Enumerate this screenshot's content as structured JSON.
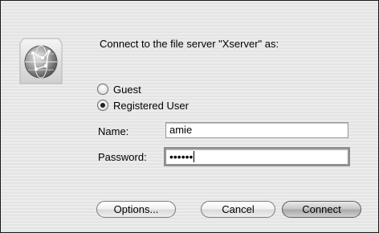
{
  "dialog": {
    "prompt": "Connect to the file server \"Xserver\" as:",
    "icon": "network-globe-icon"
  },
  "login_type": {
    "options": [
      {
        "label": "Guest",
        "selected": false
      },
      {
        "label": "Registered User",
        "selected": true
      }
    ]
  },
  "fields": {
    "name_label": "Name:",
    "name_value": "amie",
    "password_label": "Password:",
    "password_value": "••••••"
  },
  "buttons": {
    "options": "Options...",
    "cancel": "Cancel",
    "connect": "Connect"
  }
}
